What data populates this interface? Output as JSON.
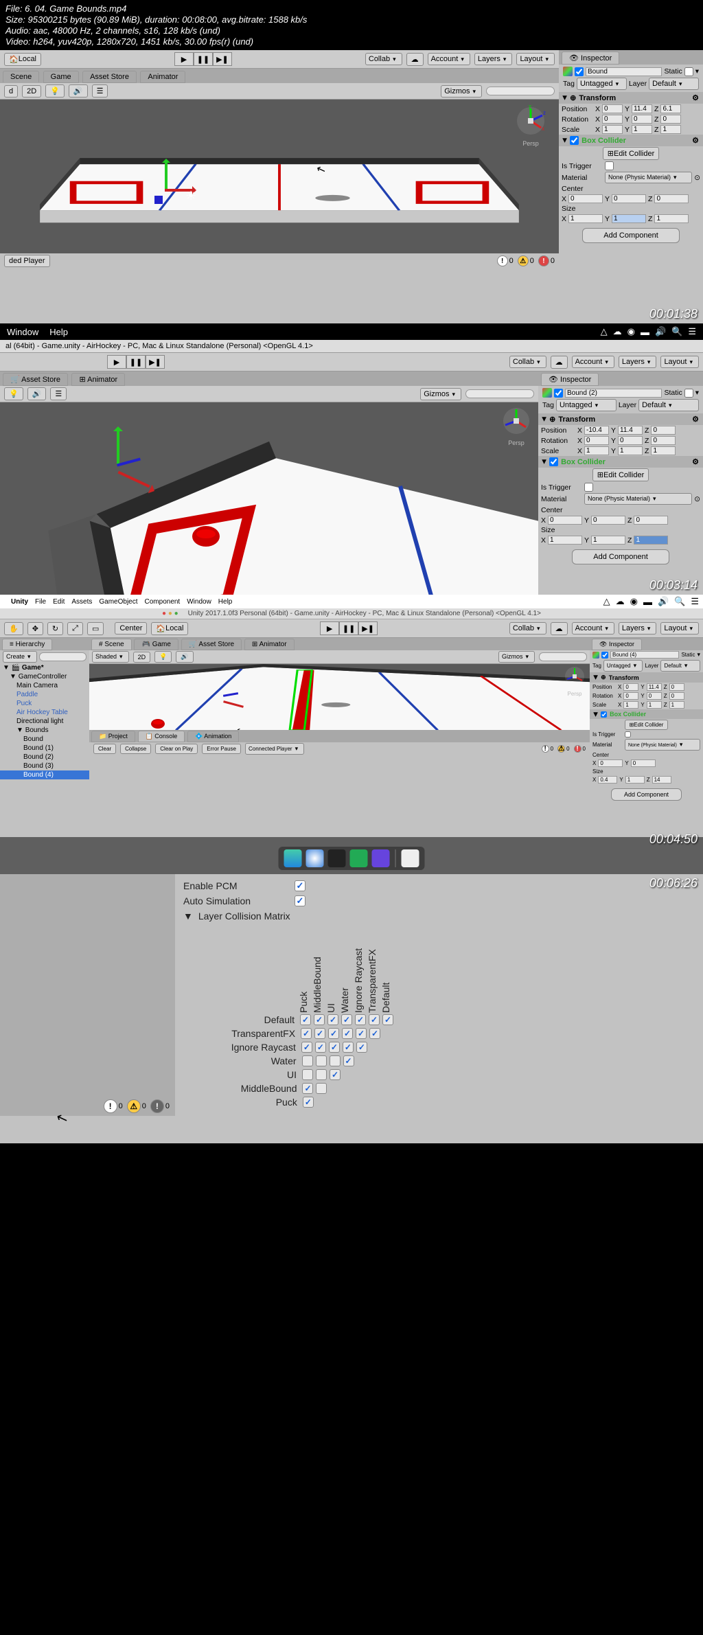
{
  "fileinfo": {
    "file": "File: 6. 04. Game Bounds.mp4",
    "size": "Size: 95300215 bytes (90.89 MiB), duration: 00:08:00, avg.bitrate: 1588 kb/s",
    "audio": "Audio: aac, 48000 Hz, 2 channels, s16, 128 kb/s (und)",
    "video": "Video: h264, yuv420p, 1280x720, 1451 kb/s, 30.00 fps(r) (und)"
  },
  "timestamps": {
    "t1": "00:01:38",
    "t2": "00:03:14",
    "t3": "00:04:50",
    "t4": "00:06:26"
  },
  "toolbar": {
    "local": "Local",
    "collab": "Collab",
    "account": "Account",
    "layers": "Layers",
    "layout": "Layout",
    "center": "Center",
    "twod": "2D",
    "gizmos": "Gizmos",
    "shaded": "Shaded"
  },
  "tabs": {
    "scene": "Scene",
    "game": "Game",
    "asset": "Asset Store",
    "animator": "Animator",
    "inspector": "Inspector",
    "hierarchy": "Hierarchy",
    "project": "Project",
    "console": "Console",
    "animation": "Animation"
  },
  "persp": "Persp",
  "status": {
    "collapse": "Collapse",
    "clearplay": "Clear on Play",
    "errorpause": "Error Pause",
    "connected": "Connected Player",
    "ded_player": "ded Player"
  },
  "frame1": {
    "obj": "Bound",
    "tag": "Untagged",
    "layer": "Default",
    "static": "Static",
    "transform": "Transform",
    "position": "Position",
    "rotation": "Rotation",
    "scale": "Scale",
    "pos": {
      "x": "0",
      "y": "11.4",
      "z": "6.1"
    },
    "rot": {
      "x": "0",
      "y": "0",
      "z": "0"
    },
    "scl": {
      "x": "1",
      "y": "1",
      "z": "1"
    },
    "boxcol": "Box Collider",
    "editcol": "Edit Collider",
    "istrigger": "Is Trigger",
    "material": "Material",
    "matv": "None (Physic Material)",
    "center": "Center",
    "centerv": {
      "x": "0",
      "y": "0",
      "z": "0"
    },
    "sizel": "Size",
    "sizev": {
      "x": "1",
      "y": "1",
      "z": "1"
    },
    "addcomp": "Add Component"
  },
  "frame2": {
    "menu_window": "Window",
    "menu_help": "Help",
    "title": "al (64bit) - Game.unity - AirHockey - PC, Mac & Linux Standalone (Personal) <OpenGL 4.1>",
    "obj": "Bound (2)",
    "tag": "Untagged",
    "layer": "Default",
    "static": "Static",
    "pos": {
      "x": "-10.4",
      "y": "11.4",
      "z": "0"
    },
    "rot": {
      "x": "0",
      "y": "0",
      "z": "0"
    },
    "scl": {
      "x": "1",
      "y": "1",
      "z": "1"
    },
    "centerv": {
      "x": "0",
      "y": "0",
      "z": "0"
    },
    "sizev": {
      "x": "1",
      "y": "1",
      "z": "1"
    }
  },
  "frame3": {
    "menubar": [
      "Unity",
      "File",
      "Edit",
      "Assets",
      "GameObject",
      "Component",
      "Window",
      "Help"
    ],
    "title": "Unity 2017.1.0f3 Personal (64bit) - Game.unity - AirHockey - PC, Mac & Linux Standalone (Personal) <OpenGL 4.1>",
    "create": "Create",
    "gameobj": "Game*",
    "hier": {
      "gc": "GameController",
      "cam": "Main Camera",
      "paddle": "Paddle",
      "puck": "Puck",
      "table": "Air Hockey Table",
      "light": "Directional light",
      "bounds": "Bounds",
      "b0": "Bound",
      "b1": "Bound (1)",
      "b2": "Bound (2)",
      "b3": "Bound (3)",
      "b4": "Bound (4)"
    },
    "obj": "Bound (4)",
    "tag": "Untagged",
    "layer": "Default",
    "pos": {
      "x": "0",
      "y": "11.4",
      "z": "0"
    },
    "rot": {
      "x": "0",
      "y": "0",
      "z": "0"
    },
    "scl": {
      "x": "1",
      "y": "1",
      "z": "1"
    },
    "centerv": {
      "x": "0",
      "y": "0"
    },
    "sizev": {
      "x": "0.4",
      "y": "1",
      "z": "14"
    },
    "matv": "None (Physic Material)"
  },
  "frame4": {
    "enable_pcm": "Enable PCM",
    "auto_sim": "Auto Simulation",
    "lcm": "Layer Collision Matrix",
    "layers": [
      "Default",
      "TransparentFX",
      "Ignore Raycast",
      "Water",
      "UI",
      "MiddleBound",
      "Puck"
    ],
    "counts": {
      "a": "0",
      "b": "0",
      "c": "0"
    }
  },
  "labels": {
    "tag": "Tag",
    "layer": "Layer"
  },
  "collision_empty": [
    [
      3,
      4
    ],
    [
      3,
      5
    ],
    [
      3,
      6
    ],
    [
      4,
      5
    ],
    [
      4,
      6
    ],
    [
      5,
      5
    ]
  ]
}
